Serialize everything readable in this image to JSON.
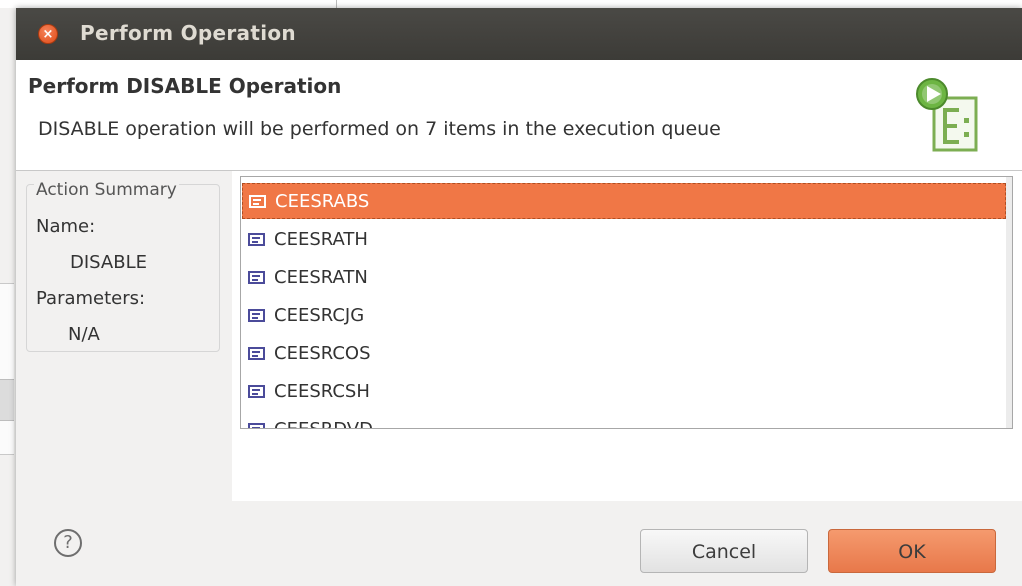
{
  "window": {
    "title": "Perform Operation",
    "close_glyph": "×"
  },
  "header": {
    "title": "Perform DISABLE Operation",
    "description": "DISABLE operation will be performed on 7 items in the execution queue",
    "icon": "wizard-run-icon"
  },
  "summary": {
    "legend": "Action Summary",
    "name_label": "Name:",
    "name_value": "DISABLE",
    "params_label": "Parameters:",
    "params_value": "N/A"
  },
  "items": {
    "list": [
      {
        "label": "CEESRABS",
        "selected": true
      },
      {
        "label": "CEESRATH",
        "selected": false
      },
      {
        "label": "CEESRATN",
        "selected": false
      },
      {
        "label": "CEESRCJG",
        "selected": false
      },
      {
        "label": "CEESRCOS",
        "selected": false
      },
      {
        "label": "CEESRCSH",
        "selected": false
      },
      {
        "label": "CEESRDVD",
        "selected": false
      }
    ]
  },
  "footer": {
    "help_glyph": "?",
    "cancel_label": "Cancel",
    "ok_label": "OK"
  },
  "colors": {
    "selection": "#f07746",
    "titlebar": "#3c3b37",
    "ok_button": "#e8784a"
  }
}
